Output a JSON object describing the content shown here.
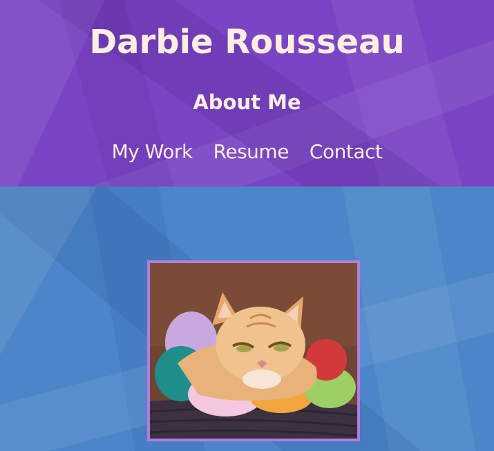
{
  "header": {
    "title": "Darbie Rousseau",
    "subtitle": "About Me"
  },
  "nav": {
    "items": [
      {
        "label": "My Work"
      },
      {
        "label": "Resume"
      },
      {
        "label": "Contact"
      }
    ]
  },
  "main": {
    "photo_alt": "Orange tabby cat resting on a colorful plush donut cushion"
  },
  "colors": {
    "header_bg": "#7a45c4",
    "main_bg": "#4c86c8",
    "text": "#fcefe0",
    "photo_border": "#b07ee0"
  }
}
